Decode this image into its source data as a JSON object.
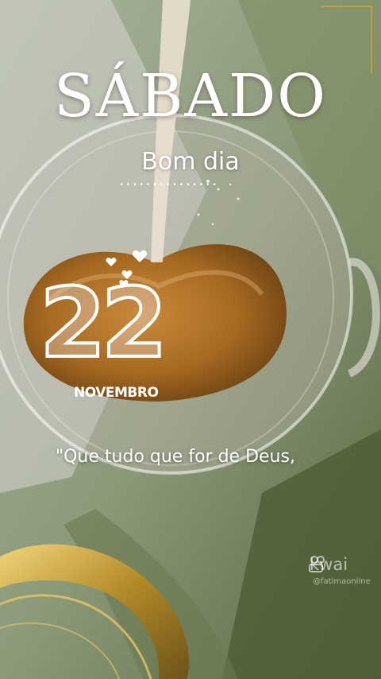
{
  "day_name": "SÁBADO",
  "greeting": "Bom dia",
  "day_number": "22",
  "month": "NOVEMBRO",
  "quote": "\"Que tudo que for de Deus,",
  "watermark": {
    "brand": "kwai",
    "handle": "@fatimaonline",
    "icon": "kwai-logo-icon"
  },
  "colors": {
    "text": "#ffffff",
    "coffee": "#b3752a",
    "gold": "#c9a23a",
    "leaf": "#5d6e45"
  }
}
